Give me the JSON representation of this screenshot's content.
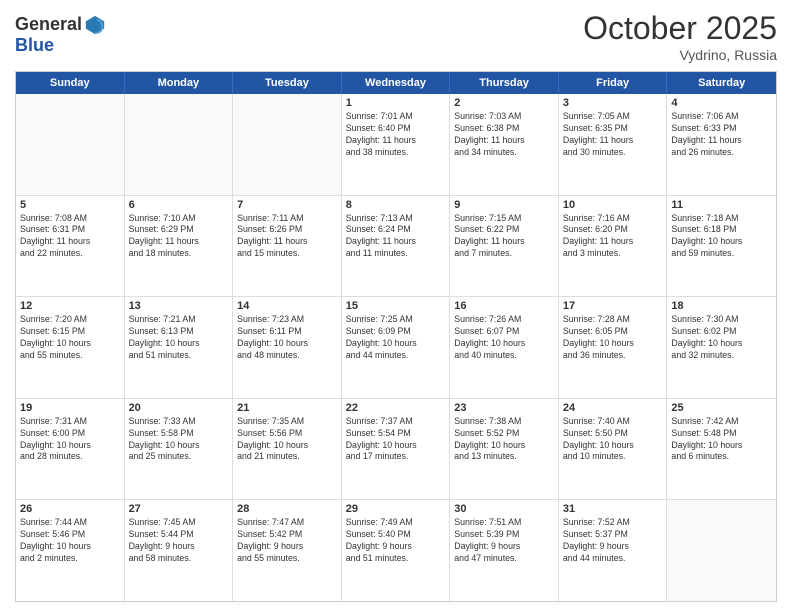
{
  "header": {
    "logo_general": "General",
    "logo_blue": "Blue",
    "month": "October 2025",
    "location": "Vydrino, Russia"
  },
  "weekdays": [
    "Sunday",
    "Monday",
    "Tuesday",
    "Wednesday",
    "Thursday",
    "Friday",
    "Saturday"
  ],
  "rows": [
    [
      {
        "day": "",
        "empty": true,
        "detail": ""
      },
      {
        "day": "",
        "empty": true,
        "detail": ""
      },
      {
        "day": "",
        "empty": true,
        "detail": ""
      },
      {
        "day": "1",
        "detail": "Sunrise: 7:01 AM\nSunset: 6:40 PM\nDaylight: 11 hours\nand 38 minutes."
      },
      {
        "day": "2",
        "detail": "Sunrise: 7:03 AM\nSunset: 6:38 PM\nDaylight: 11 hours\nand 34 minutes."
      },
      {
        "day": "3",
        "detail": "Sunrise: 7:05 AM\nSunset: 6:35 PM\nDaylight: 11 hours\nand 30 minutes."
      },
      {
        "day": "4",
        "detail": "Sunrise: 7:06 AM\nSunset: 6:33 PM\nDaylight: 11 hours\nand 26 minutes."
      }
    ],
    [
      {
        "day": "5",
        "detail": "Sunrise: 7:08 AM\nSunset: 6:31 PM\nDaylight: 11 hours\nand 22 minutes."
      },
      {
        "day": "6",
        "detail": "Sunrise: 7:10 AM\nSunset: 6:29 PM\nDaylight: 11 hours\nand 18 minutes."
      },
      {
        "day": "7",
        "detail": "Sunrise: 7:11 AM\nSunset: 6:26 PM\nDaylight: 11 hours\nand 15 minutes."
      },
      {
        "day": "8",
        "detail": "Sunrise: 7:13 AM\nSunset: 6:24 PM\nDaylight: 11 hours\nand 11 minutes."
      },
      {
        "day": "9",
        "detail": "Sunrise: 7:15 AM\nSunset: 6:22 PM\nDaylight: 11 hours\nand 7 minutes."
      },
      {
        "day": "10",
        "detail": "Sunrise: 7:16 AM\nSunset: 6:20 PM\nDaylight: 11 hours\nand 3 minutes."
      },
      {
        "day": "11",
        "detail": "Sunrise: 7:18 AM\nSunset: 6:18 PM\nDaylight: 10 hours\nand 59 minutes."
      }
    ],
    [
      {
        "day": "12",
        "detail": "Sunrise: 7:20 AM\nSunset: 6:15 PM\nDaylight: 10 hours\nand 55 minutes."
      },
      {
        "day": "13",
        "detail": "Sunrise: 7:21 AM\nSunset: 6:13 PM\nDaylight: 10 hours\nand 51 minutes."
      },
      {
        "day": "14",
        "detail": "Sunrise: 7:23 AM\nSunset: 6:11 PM\nDaylight: 10 hours\nand 48 minutes."
      },
      {
        "day": "15",
        "detail": "Sunrise: 7:25 AM\nSunset: 6:09 PM\nDaylight: 10 hours\nand 44 minutes."
      },
      {
        "day": "16",
        "detail": "Sunrise: 7:26 AM\nSunset: 6:07 PM\nDaylight: 10 hours\nand 40 minutes."
      },
      {
        "day": "17",
        "detail": "Sunrise: 7:28 AM\nSunset: 6:05 PM\nDaylight: 10 hours\nand 36 minutes."
      },
      {
        "day": "18",
        "detail": "Sunrise: 7:30 AM\nSunset: 6:02 PM\nDaylight: 10 hours\nand 32 minutes."
      }
    ],
    [
      {
        "day": "19",
        "detail": "Sunrise: 7:31 AM\nSunset: 6:00 PM\nDaylight: 10 hours\nand 28 minutes."
      },
      {
        "day": "20",
        "detail": "Sunrise: 7:33 AM\nSunset: 5:58 PM\nDaylight: 10 hours\nand 25 minutes."
      },
      {
        "day": "21",
        "detail": "Sunrise: 7:35 AM\nSunset: 5:56 PM\nDaylight: 10 hours\nand 21 minutes."
      },
      {
        "day": "22",
        "detail": "Sunrise: 7:37 AM\nSunset: 5:54 PM\nDaylight: 10 hours\nand 17 minutes."
      },
      {
        "day": "23",
        "detail": "Sunrise: 7:38 AM\nSunset: 5:52 PM\nDaylight: 10 hours\nand 13 minutes."
      },
      {
        "day": "24",
        "detail": "Sunrise: 7:40 AM\nSunset: 5:50 PM\nDaylight: 10 hours\nand 10 minutes."
      },
      {
        "day": "25",
        "detail": "Sunrise: 7:42 AM\nSunset: 5:48 PM\nDaylight: 10 hours\nand 6 minutes."
      }
    ],
    [
      {
        "day": "26",
        "detail": "Sunrise: 7:44 AM\nSunset: 5:46 PM\nDaylight: 10 hours\nand 2 minutes."
      },
      {
        "day": "27",
        "detail": "Sunrise: 7:45 AM\nSunset: 5:44 PM\nDaylight: 9 hours\nand 58 minutes."
      },
      {
        "day": "28",
        "detail": "Sunrise: 7:47 AM\nSunset: 5:42 PM\nDaylight: 9 hours\nand 55 minutes."
      },
      {
        "day": "29",
        "detail": "Sunrise: 7:49 AM\nSunset: 5:40 PM\nDaylight: 9 hours\nand 51 minutes."
      },
      {
        "day": "30",
        "detail": "Sunrise: 7:51 AM\nSunset: 5:39 PM\nDaylight: 9 hours\nand 47 minutes."
      },
      {
        "day": "31",
        "detail": "Sunrise: 7:52 AM\nSunset: 5:37 PM\nDaylight: 9 hours\nand 44 minutes."
      },
      {
        "day": "",
        "empty": true,
        "detail": ""
      }
    ]
  ]
}
